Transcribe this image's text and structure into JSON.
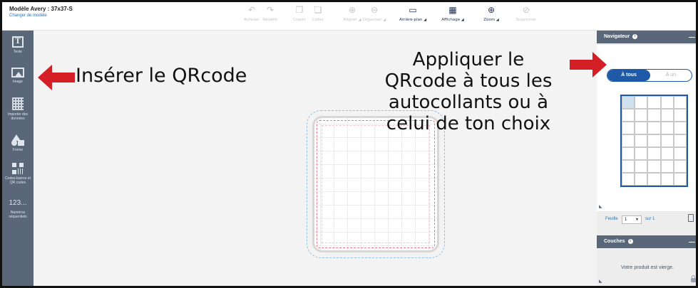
{
  "header": {
    "model_title": "Modèle Avery : 37x37-S",
    "change_model_link": "Changer de modèle"
  },
  "toolbar": {
    "items": [
      {
        "label": "Annuler",
        "icon": "undo-icon",
        "enabled": false
      },
      {
        "label": "Rétablir",
        "icon": "redo-icon",
        "enabled": false
      },
      {
        "label": "Copier",
        "icon": "copy-icon",
        "enabled": false
      },
      {
        "label": "Coller",
        "icon": "paste-icon",
        "enabled": false
      },
      {
        "label": "Aligner",
        "icon": "align-icon",
        "enabled": false
      },
      {
        "label": "Organiser",
        "icon": "arrange-icon",
        "enabled": false
      },
      {
        "label": "Arrière-plan",
        "icon": "background-icon",
        "enabled": true
      },
      {
        "label": "Affichage",
        "icon": "grid-view-icon",
        "enabled": true
      },
      {
        "label": "Zoom",
        "icon": "zoom-icon",
        "enabled": true
      },
      {
        "label": "Supprimer",
        "icon": "delete-icon",
        "enabled": false
      }
    ]
  },
  "sidebar": {
    "items": [
      {
        "label": "Texte",
        "icon": "text-icon"
      },
      {
        "label": "Image",
        "icon": "image-icon"
      },
      {
        "label": "Importer des données",
        "icon": "import-data-icon"
      },
      {
        "label": "Forme",
        "icon": "shape-icon"
      },
      {
        "label": "Codes-barres et QR codes",
        "icon": "qr-code-icon"
      },
      {
        "label": "Numéros séquentiels",
        "icon": "sequential-numbers-icon",
        "glyph": "123..."
      }
    ]
  },
  "navigator": {
    "title": "Navigateur",
    "apply_all": "À tous",
    "apply_one": "À un",
    "sheet_label": "Feuille",
    "sheet_value": "1",
    "sheet_of": "sur 1"
  },
  "layers": {
    "title": "Couches",
    "empty_message": "Votre produit est vierge."
  },
  "annotations": {
    "left": "Insérer le QRcode",
    "right": "Appliquer le\nQRcode à tous les\nautocollants ou à\ncelui de ton choix"
  },
  "colors": {
    "sidebar": "#5a6778",
    "accent": "#1e5aa8",
    "annotation_arrow": "#d41f26"
  }
}
